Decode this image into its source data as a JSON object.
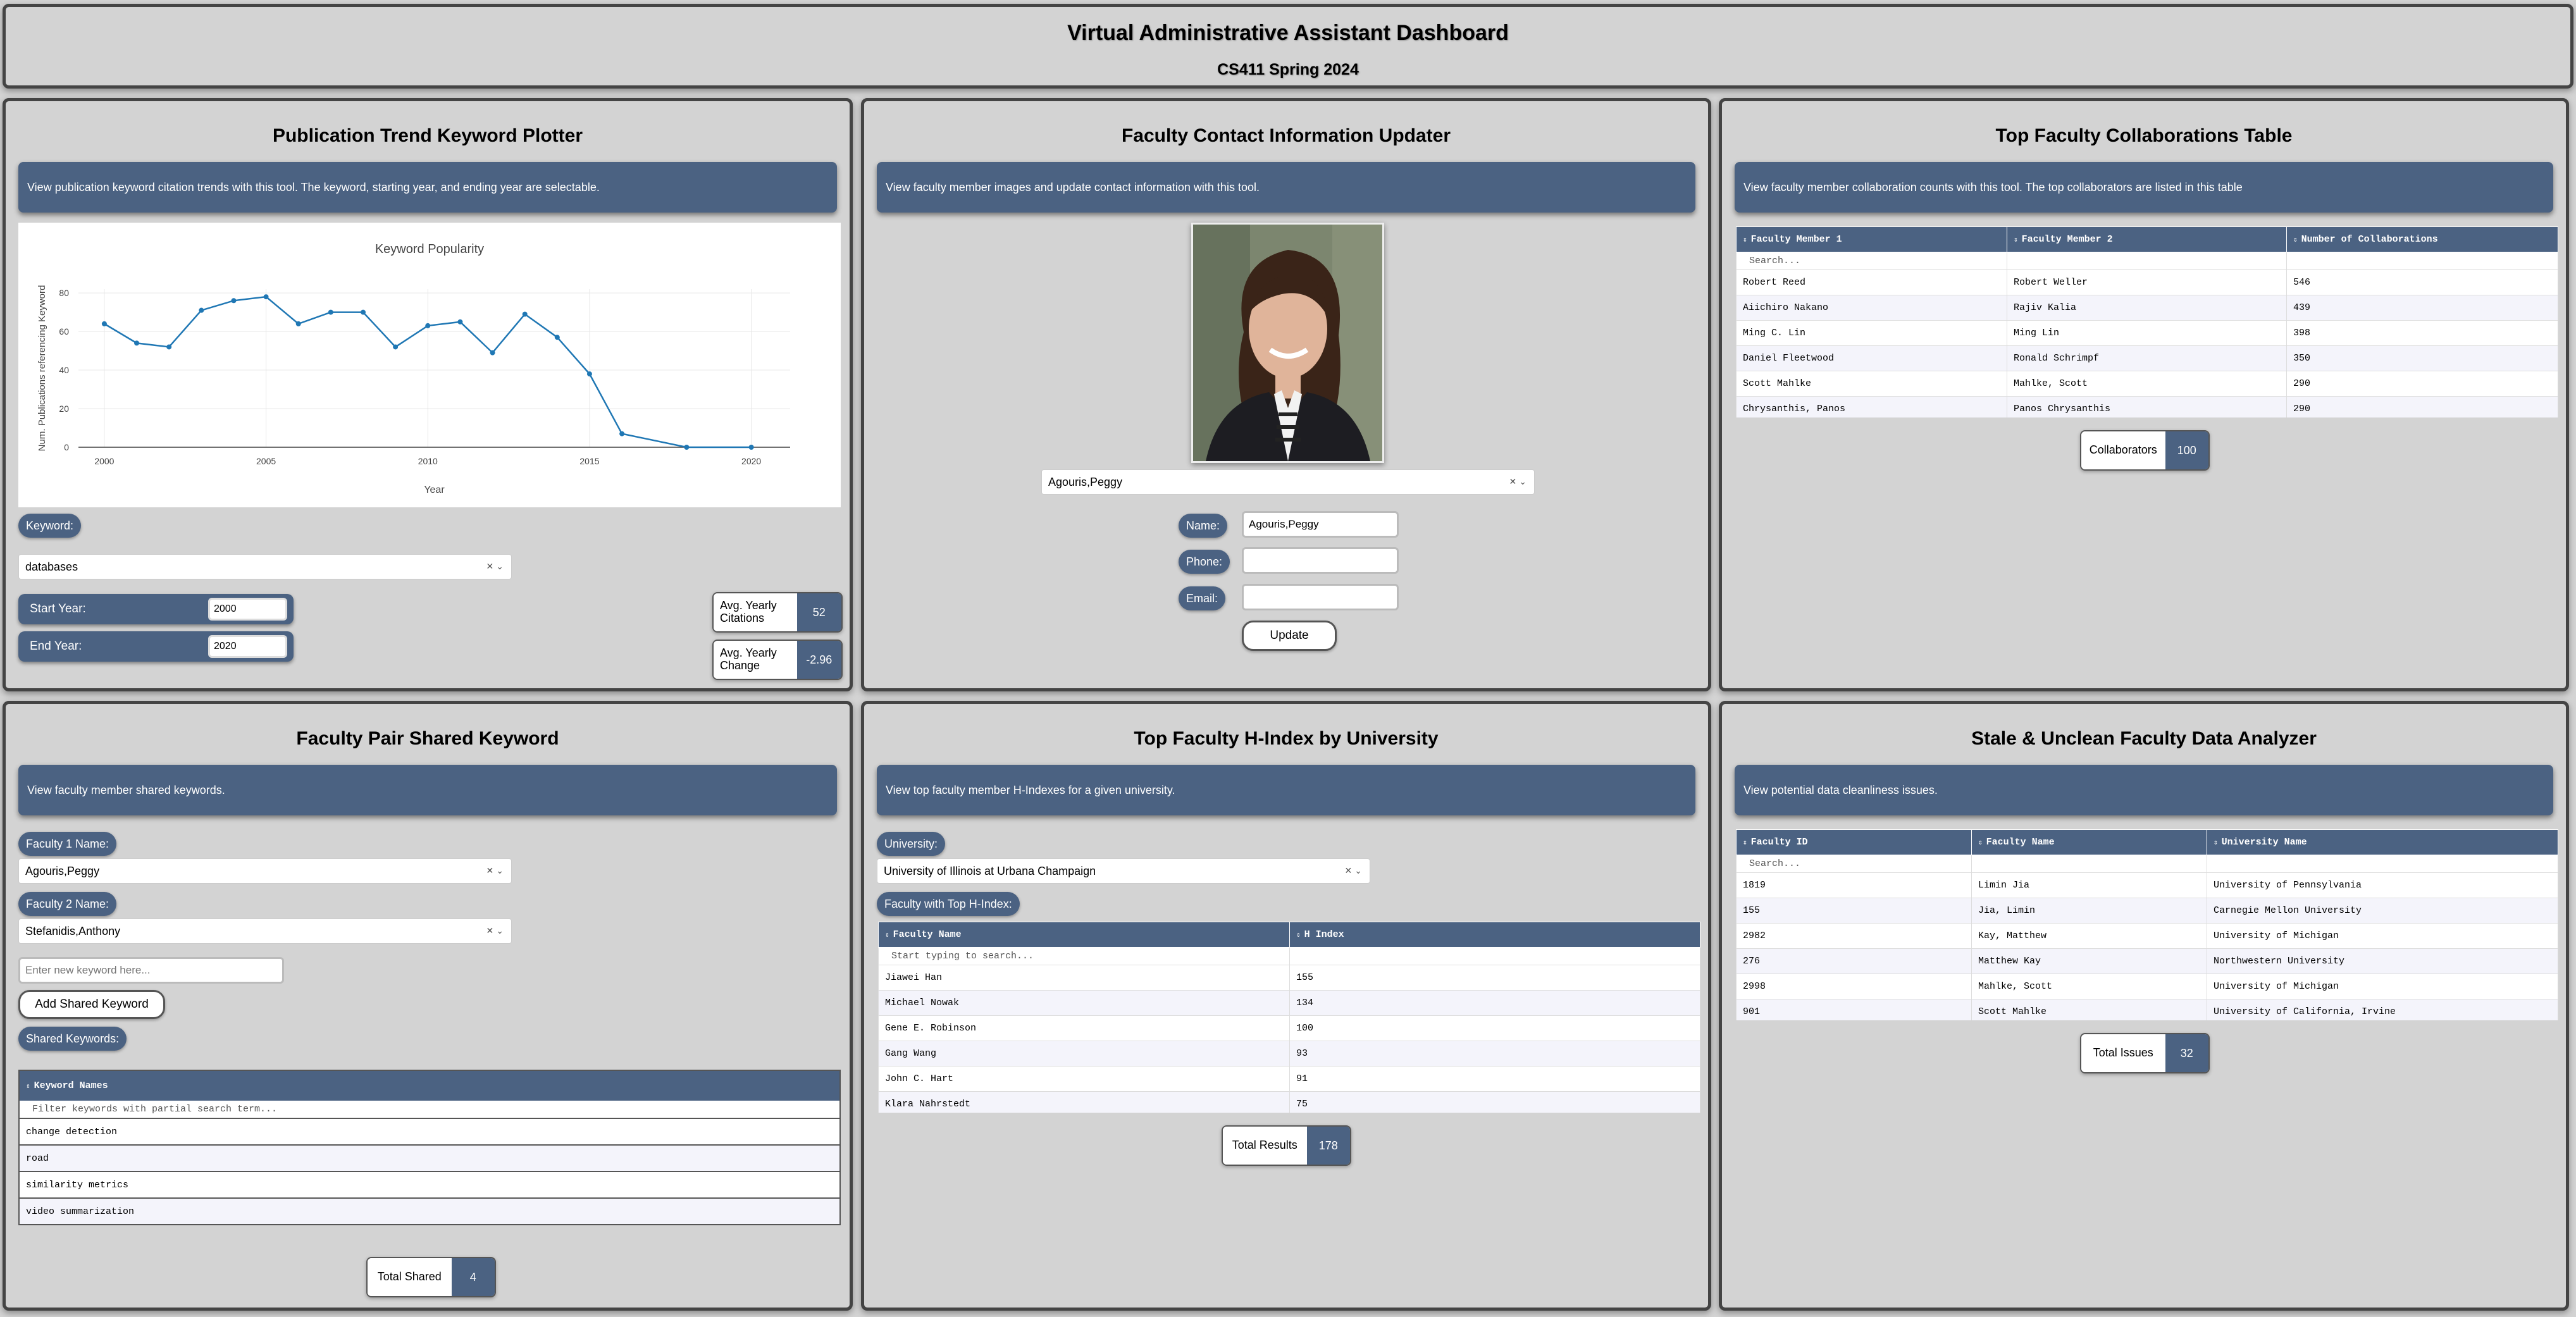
{
  "header": {
    "title": "Virtual Administrative Assistant Dashboard",
    "subtitle": "CS411 Spring 2024"
  },
  "pub": {
    "title": "Publication Trend Keyword Plotter",
    "desc": "View publication keyword citation trends with this tool. The keyword, starting year, and ending year are selectable.",
    "keyword_label": "Keyword:",
    "keyword_value": "databases",
    "start_label": "Start Year:",
    "start_value": "2000",
    "end_label": "End Year:",
    "end_value": "2020",
    "avg_cit_label": "Avg. Yearly Citations",
    "avg_cit_value": "52",
    "avg_chg_label": "Avg. Yearly Change",
    "avg_chg_value": "-2.96"
  },
  "chart_data": {
    "type": "line",
    "title": "Keyword Popularity",
    "xlabel": "Year",
    "ylabel": "Num. Publications referencing Keyword",
    "x": [
      2000,
      2001,
      2002,
      2003,
      2004,
      2005,
      2006,
      2007,
      2008,
      2009,
      2010,
      2011,
      2012,
      2013,
      2014,
      2015,
      2016,
      2018,
      2020
    ],
    "y": [
      64,
      54,
      52,
      71,
      76,
      78,
      64,
      70,
      70,
      52,
      63,
      65,
      49,
      69,
      57,
      38,
      7,
      0,
      0
    ],
    "xlim": [
      1999.2,
      2021.2
    ],
    "ylim": [
      0,
      82
    ],
    "xticks": [
      2000,
      2005,
      2010,
      2015,
      2020
    ],
    "yticks": [
      0,
      20,
      40,
      60,
      80
    ],
    "color": "#1f77b4"
  },
  "contact": {
    "title": "Faculty Contact Information Updater",
    "desc": "View faculty member images and update contact information with this tool.",
    "selected": "Agouris,Peggy",
    "name_label": "Name:",
    "name_value": "Agouris,Peggy",
    "phone_label": "Phone:",
    "email_label": "Email:",
    "update_label": "Update"
  },
  "collab": {
    "title": "Top Faculty Collaborations Table",
    "desc": "View faculty member collaboration counts with this tool. The top collaborators are listed in this table",
    "headers": [
      "Faculty Member 1",
      "Faculty Member 2",
      "Number of Collaborations"
    ],
    "search": "Search...",
    "rows": [
      [
        "Robert Reed",
        "Robert Weller",
        "546"
      ],
      [
        "Aiichiro Nakano",
        "Rajiv Kalia",
        "439"
      ],
      [
        "Ming C. Lin",
        "Ming Lin",
        "398"
      ],
      [
        "Daniel Fleetwood",
        "Ronald Schrimpf",
        "350"
      ],
      [
        "Scott Mahlke",
        "Mahlke, Scott",
        "290"
      ],
      [
        "Chrysanthis, Panos",
        "Panos Chrysanthis",
        "290"
      ]
    ],
    "stat_label": "Collaborators",
    "stat_value": "100"
  },
  "shared": {
    "title": "Faculty Pair Shared Keyword",
    "desc": "View faculty member shared keywords.",
    "f1_label": "Faculty 1 Name:",
    "f1_value": "Agouris,Peggy",
    "f2_label": "Faculty 2 Name:",
    "f2_value": "Stefanidis,Anthony",
    "new_placeholder": "Enter new keyword here...",
    "add_label": "Add Shared Keyword",
    "shared_label": "Shared Keywords:",
    "header": "Keyword Names",
    "filter": "Filter keywords with partial search term...",
    "rows": [
      "change detection",
      "road",
      "similarity metrics",
      "video summarization"
    ],
    "stat_label": "Total Shared",
    "stat_value": "4"
  },
  "hindex": {
    "title": "Top Faculty H-Index by University",
    "desc": "View top faculty member H-Indexes for a given university.",
    "uni_label": "University:",
    "uni_value": "University of Illinois at Urbana Champaign",
    "top_label": "Faculty with Top H-Index:",
    "headers": [
      "Faculty Name",
      "H Index"
    ],
    "search": "Start typing to search...",
    "rows": [
      [
        "Jiawei Han",
        "155"
      ],
      [
        "Michael Nowak",
        "134"
      ],
      [
        "Gene E. Robinson",
        "100"
      ],
      [
        "Gang Wang",
        "93"
      ],
      [
        "John C. Hart",
        "91"
      ],
      [
        "Klara Nahrstedt",
        "75"
      ]
    ],
    "stat_label": "Total Results",
    "stat_value": "178"
  },
  "stale": {
    "title": "Stale & Unclean Faculty Data Analyzer",
    "desc": "View potential data cleanliness issues.",
    "headers": [
      "Faculty ID",
      "Faculty Name",
      "University Name"
    ],
    "search": "Search...",
    "rows": [
      [
        "1819",
        "Limin Jia",
        "University of Pennsylvania"
      ],
      [
        "155",
        "Jia, Limin",
        "Carnegie Mellon University"
      ],
      [
        "2982",
        "Kay, Matthew",
        "University of Michigan"
      ],
      [
        "276",
        "Matthew Kay",
        "Northwestern University"
      ],
      [
        "2998",
        "Mahlke, Scott",
        "University of Michigan"
      ],
      [
        "901",
        "Scott Mahlke",
        "University of California, Irvine"
      ]
    ],
    "stat_label": "Total Issues",
    "stat_value": "32"
  }
}
